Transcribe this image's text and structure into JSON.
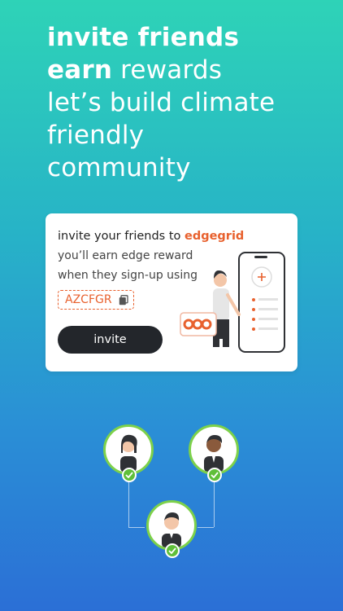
{
  "headline": {
    "line1": "invite friends",
    "line2_bold": "earn",
    "line2_rest": " rewards",
    "line3": "let’s build climate",
    "line4": "friendly",
    "line5": "community"
  },
  "card": {
    "title_prefix": "invite your friends to ",
    "brand": "edgegrid",
    "line1": "you’ll earn edge reward",
    "line2": "when they sign-up using",
    "referral_code": "AZCFGR",
    "invite_label": "invite"
  },
  "colors": {
    "accent": "#e8612e",
    "button": "#23262b",
    "avatar_ring": "#7dd14a",
    "check": "#5fbf3a"
  },
  "icons": [
    "copy-icon",
    "check-icon",
    "illustration-person-phone"
  ]
}
